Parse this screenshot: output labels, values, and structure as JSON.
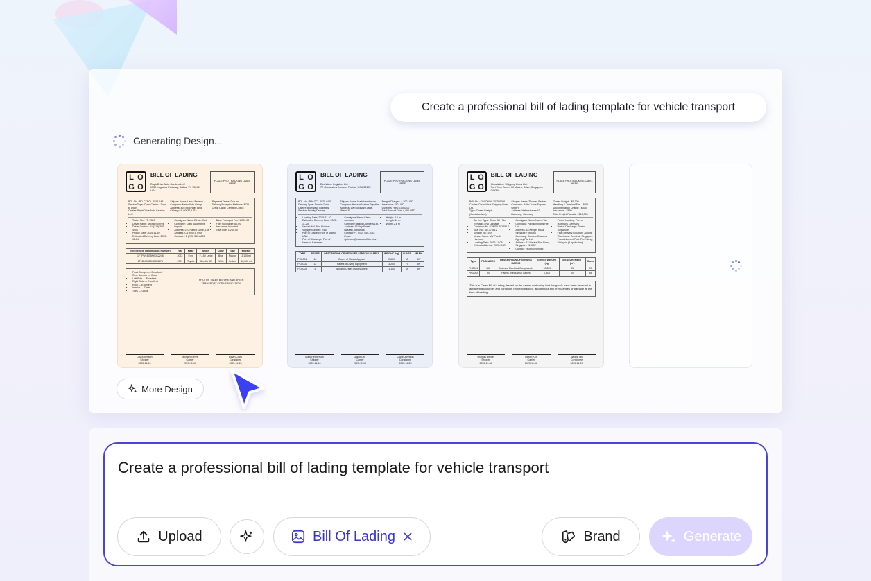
{
  "prompt_bubble": "Create a professional bill of lading template for vehicle transport",
  "status_text": "Generating Design...",
  "more_design_label": "More Design",
  "input": {
    "value": "Create a professional bill of lading template for vehicle transport"
  },
  "buttons": {
    "upload": "Upload",
    "tag": "Bill Of Lading",
    "brand": "Brand",
    "generate": "Generate"
  },
  "colors": {
    "accent": "#4a45d6",
    "card1_bg": "#fdf1e4",
    "card2_bg": "#e9eef7",
    "card3_bg": "#f4f4f4",
    "generate_bg": "#dcd6ff"
  },
  "icons": [
    "sparkle-icon",
    "upload-icon",
    "magic-icon",
    "image-edit-icon",
    "close-icon",
    "brand-icon",
    "cursor-pointer-icon",
    "spinner-icon"
  ],
  "cards": [
    {
      "logo": [
        "L",
        "O",
        "G",
        "O"
      ],
      "title": "BILL OF LADING",
      "address": "RapidDrive Auto Carriers LLC\n1550 Logistics Parkway, Dallas, TX 75245, USA",
      "tracking": "PLACE PRO TRACKING LABEL HERE",
      "col1": "BOL No.: RD-CTBOL-2025-143\nService Type: Open Carrier - Door to Door\nCarrier: RapidDrive Auto Carriers LLC",
      "col2": "Shipper Name: Laura Benson\nCompany: Metro Auto Group\nAddress: 425 Motorway Blvd, Chicago, IL 60632, USA",
      "col3": "Payment Terms: Due on Delivery/Accepted Methods: ACH / Credit Card / Certified Check",
      "list1": [
        "Trailer No.: TR-7820",
        "Driver Name: Michael Torres",
        "Driver Contact: +1 (214) 555-4401",
        "Pickup Date: 2025-11-10",
        "Estimated Delivery Date: 2025-11-14"
      ],
      "list2": [
        "Consignee Name:Ethan Clark",
        "Company: Clark Automotive Imports",
        "Address: 210 Harbor Drive, Los Angeles, CA 90021, USA",
        "Contact: +1 (213) 555-8603"
      ],
      "list3": [
        "Base Transport Fee: 1,200.00",
        "Fuel Surcharge: 60.00",
        "Insurance: Included",
        "Total Due: 1,260.00"
      ],
      "table_head": [
        "VIN (Vehicle Identification Number)",
        "Year",
        "Make",
        "Model",
        "Color",
        "Type",
        "Mileage"
      ],
      "table_rows": [
        [
          "1FTFW1EG8NKD12245",
          "2022",
          "Ford",
          "F-150 Lariat",
          "Blue",
          "Pickup",
          "2,100 mi"
        ],
        [
          "2T1BURHE5JC083876",
          "2021",
          "Toyota",
          "Corolla SE",
          "White",
          "Sedan",
          "18,600 mi"
        ]
      ],
      "cond": [
        "Front Bumper — Excellent",
        "Rear Bumper — Good",
        "Left Side — Excellent",
        "Right Side — Excellent",
        "Roof — Excellent",
        "Interior — Clean",
        "Tires — Good"
      ],
      "photo": "PHOTOS TAKEN BEFORE AND AFTER TRANSPORT FOR VERIFICATION.",
      "sigs": [
        [
          "Laura Benson",
          "Shipper",
          "2025-11-10"
        ],
        [
          "Michael Torres",
          "Carrier",
          "2025-11-10"
        ],
        [
          "Ethan Clark",
          "Consignee",
          "2025-11-15"
        ]
      ]
    },
    {
      "logo": [
        "L",
        "O",
        "G",
        "O"
      ],
      "title": "BILL OF LADING",
      "address": "BlueWave Logistics Ltd.\n77 Oceanview Avenue, Florida, USA 33102",
      "tracking": "PLACE PRO TRACKING LABEL HERE",
      "col1": "BOL No.: BW-OCL-2025-0115\nDelivery Type: Door to Door\nCarrier: BlueWave Logistics\nService: Priority Delivery",
      "col2": "Shipper Name: Mark Henderson\nCompany: Horizon Marine Supplies\nAddress: 190 Dockyard Lane, Miami, FL",
      "col3": "Freight Charges: 4,200 USD\nInsurance: 150 USD\nCustoms Fees: 100 USD\nTotal Amount Due: 4,450 USD",
      "list1": [
        "Loading Date: 2025-11-10",
        "Estimated Delivery Date: 2025-11-25",
        "Vessel: MV Blue Horizon",
        "Voyage Number: V415",
        "Port of Loading: Port of Miami, USA",
        "Port of Discharge: Port of Nassau, Bahamas"
      ],
      "list2": [
        "Consignee Name:Claire Johnson",
        "Company: Island Outfitters Ltd.",
        "Address: 15 Bay Street, Nassau, Bahamas",
        "Contact: +1 (242) 555-1033",
        "Email: cjohnson@islandoutfitters.bs"
      ],
      "list3": [
        "Height: 3.5 m",
        "Length: 11 m",
        "Width: 2.6 m"
      ],
      "table_head": [
        "TYPE",
        "PIECES",
        "DESCRIPTION OF ARTICLES / SPECIAL MARKS",
        "WEIGHT (kg)",
        "CLASS",
        "MARK"
      ],
      "table_rows": [
        [
          "PKG001",
          "40",
          "Boxes of Marine Apparel",
          "2,600",
          "65",
          "BW"
        ],
        [
          "PKG002",
          "12",
          "Pallets of Diving Equipment",
          "3,200",
          "70",
          "BW"
        ],
        [
          "PKG003",
          "5",
          "Wooden Crates (Accessories)",
          "1,100",
          "55",
          "BW"
        ]
      ],
      "sigs": [
        [
          "Mark Henderson",
          "Shipper",
          "2025-11-10"
        ],
        [
          "Jason Lee",
          "Carrier",
          "2025-11-10"
        ],
        [
          "Claire Johnson",
          "Consignee",
          "2025-11-25"
        ]
      ]
    },
    {
      "logo": [
        "L",
        "O",
        "G",
        "O"
      ],
      "title": "BILL OF LADING",
      "address": "CleanWave Shipping Lines Ltd.\nPort View Tower, 10 Marine Drive, Singapore 049318",
      "tracking": "PLACE PRO TRACKING LABEL HERE",
      "col1": "BOL No.: CW-OBOL-2025-0086\nCarrier: CleanWave Shipping Lines Ltd.\nType: Ocean Freight (Containerized)",
      "col2": "Shipper Name: Thomas Becker\nCompany: Baltic Trade Exports GmbH\nAddress: Hafenstrasse 42, Hamburg, Germany",
      "col3": "Ocean Freight - $9,300\nHandling & Terminal Fee - $950\nDocumentation Charge - $505\nInsurance - $850\nTotal Freight Payable - $10,305",
      "list1": [
        "Service Type: Clean Bill - No Remarks / No Damage",
        "Container No.: CWSU 302456-1",
        "Seal No.: SE-774512",
        "Voyage No.: V19",
        "Vessel Name: MV Pacific Harmony",
        "Loading Date: 2025-11-08",
        "Estimated Arrival: 2025-11-29"
      ],
      "list2": [
        "Consignee Name:Naomi Tan",
        "Company: Pacific Imports Pte Ltd.",
        "Address: 18 Keppel Road, Singapore 089058",
        "Company: Oceanic Customs Agency Pte Ltd.",
        "Address: 12 Marina Port Road, Singapore 018952",
        "Contact: info@oceanicsg"
      ],
      "list3": [
        "Port of Loading: Port of Hamburg, Germany",
        "Port of Discharge: Port of Singapore",
        "Final Delivery Location: Jurong Warehouse Terminal, Singapore",
        "Transshipment Port: Port Klang, Malaysia (if applicable)"
      ],
      "table_head": [
        "Type",
        "PACKAGES",
        "DESCRIPTION OF GOODS / MARKS",
        "GROSS WEIGHT (kg)",
        "MEASUREMENT (m³)",
        "Class"
      ],
      "table_rows": [
        [
          "PKG001",
          "150",
          "Crates of Electrical Components",
          "10,800",
          "35",
          "70"
        ],
        [
          "PKG002",
          "60",
          "Pallets of Industrial Cables",
          "7,500",
          "20",
          "85"
        ]
      ],
      "note": "This is a Clean Bill of Lading, issued by the carrier confirming that the goods have been received in apparent good order and condition, properly packed, and without any irregularities or damage at the time of loading.",
      "sigs": [
        [
          "Thomas Becker",
          "Shipper",
          "2025-11-08"
        ],
        [
          "Daniel Koh",
          "Carrier",
          "2025-11-08"
        ],
        [
          "Naomi Tan",
          "Consignee",
          "2025-11-29"
        ]
      ]
    }
  ]
}
